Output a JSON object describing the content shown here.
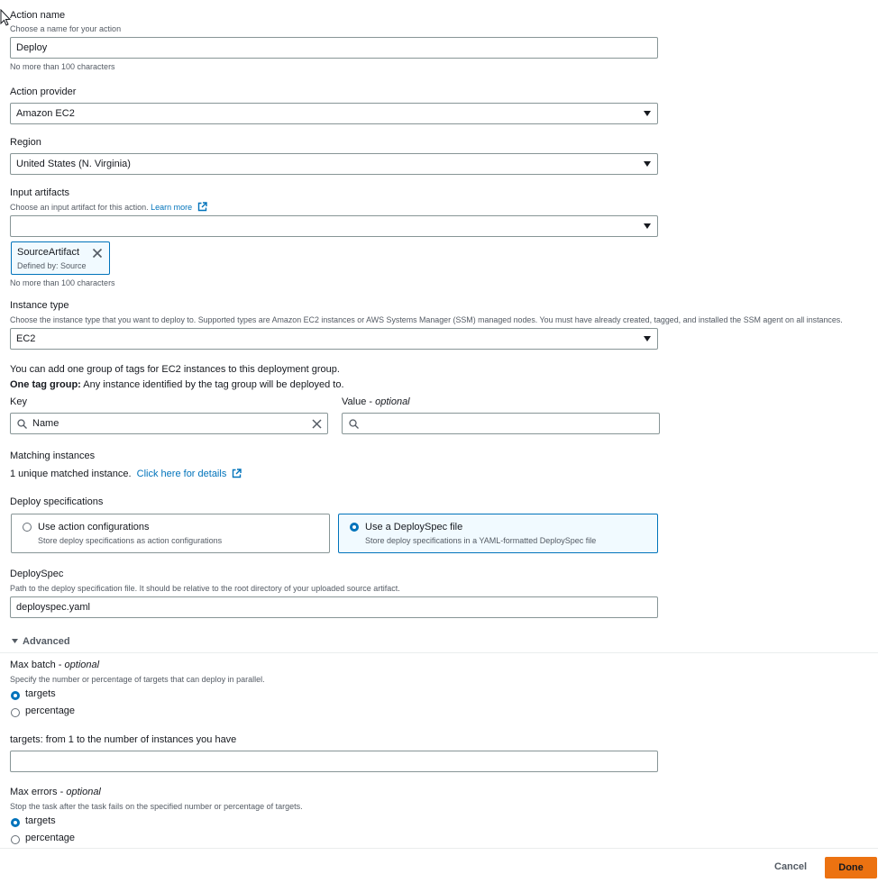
{
  "action_name": {
    "label": "Action name",
    "description": "Choose a name for your action",
    "value": "Deploy",
    "constraint": "No more than 100 characters"
  },
  "action_provider": {
    "label": "Action provider",
    "value": "Amazon EC2"
  },
  "region": {
    "label": "Region",
    "value": "United States (N. Virginia)"
  },
  "input_artifacts": {
    "label": "Input artifacts",
    "description": "Choose an input artifact for this action.",
    "learn_more": "Learn more",
    "value": "",
    "token": {
      "name": "SourceArtifact",
      "detail": "Defined by: Source"
    },
    "constraint": "No more than 100 characters"
  },
  "instance_type": {
    "label": "Instance type",
    "description": "Choose the instance type that you want to deploy to. Supported types are Amazon EC2 instances or AWS Systems Manager (SSM) managed nodes. You must have already created, tagged, and installed the SSM agent on all instances.",
    "value": "EC2"
  },
  "tags": {
    "intro": "You can add one group of tags for EC2 instances to this deployment group.",
    "group_bold": "One tag group:",
    "group_text": " Any instance identified by the tag group will be deployed to.",
    "key_label": "Key",
    "key_value": "Name",
    "value_label": "Value - ",
    "value_optional": "optional",
    "value_value": ""
  },
  "matching": {
    "label": "Matching instances",
    "text": "1 unique matched instance.",
    "link": "Click here for details"
  },
  "deploy_spec": {
    "label": "Deploy specifications",
    "options": [
      {
        "title": "Use action configurations",
        "description": "Store deploy specifications as action configurations",
        "selected": false
      },
      {
        "title": "Use a DeploySpec file",
        "description": "Store deploy specifications in a YAML-formatted DeploySpec file",
        "selected": true
      }
    ]
  },
  "deployspec": {
    "label": "DeploySpec",
    "description": "Path to the deploy specification file. It should be relative to the root directory of your uploaded source artifact.",
    "value": "deployspec.yaml"
  },
  "advanced": {
    "label": "Advanced",
    "expanded": true
  },
  "max_batch": {
    "label": "Max batch - ",
    "optional": "optional",
    "description": "Specify the number or percentage of targets that can deploy in parallel.",
    "options": [
      {
        "label": "targets",
        "selected": true
      },
      {
        "label": "percentage",
        "selected": false
      }
    ],
    "targets_label": "targets: from 1 to the number of instances you have",
    "targets_value": ""
  },
  "max_errors": {
    "label": "Max errors - ",
    "optional": "optional",
    "description": "Stop the task after the task fails on the specified number or percentage of targets.",
    "options": [
      {
        "label": "targets",
        "selected": true
      },
      {
        "label": "percentage",
        "selected": false
      }
    ]
  },
  "footer": {
    "cancel": "Cancel",
    "done": "Done"
  },
  "colors": {
    "accent": "#0073bb",
    "primary_button": "#ec7211",
    "border": "#879596"
  }
}
